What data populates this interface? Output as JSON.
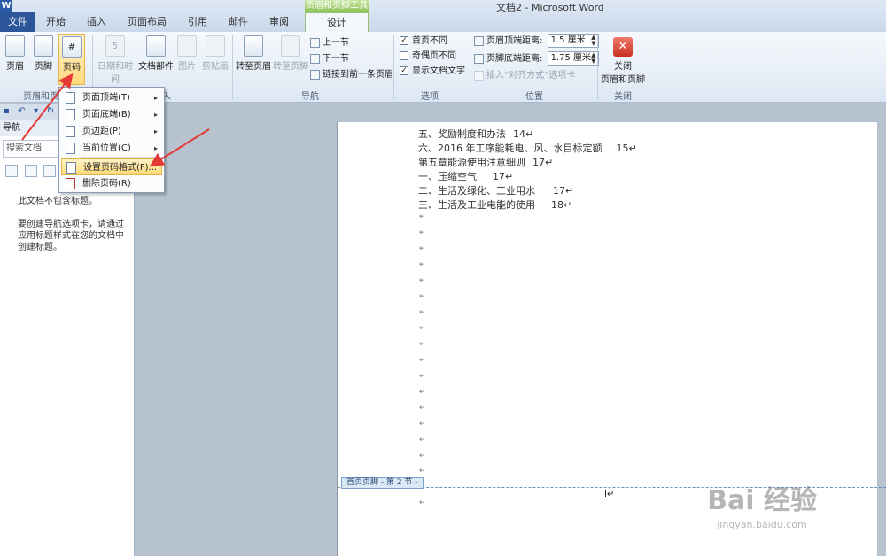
{
  "window": {
    "app_icon": "W",
    "title": "文档2 - Microsoft Word",
    "context_tab_group": "页眉和页脚工具"
  },
  "tabs": [
    {
      "label": "文件"
    },
    {
      "label": "开始"
    },
    {
      "label": "插入"
    },
    {
      "label": "页面布局"
    },
    {
      "label": "引用"
    },
    {
      "label": "邮件"
    },
    {
      "label": "审阅"
    },
    {
      "label": "视图"
    },
    {
      "label": "设计"
    }
  ],
  "ribbon": {
    "header_footer_group": {
      "label": "页眉和页",
      "buttons": [
        {
          "label": "页眉",
          "icon": "header-icon"
        },
        {
          "label": "页脚",
          "icon": "footer-icon"
        },
        {
          "label": "页码",
          "icon": "page-number-icon",
          "glyph": "#"
        }
      ]
    },
    "insert_group": {
      "label": "入",
      "buttons": [
        {
          "label": "日期和时间",
          "icon": "calendar-icon",
          "glyph": "5"
        },
        {
          "label": "文档部件",
          "icon": "quick-parts-icon"
        },
        {
          "label": "图片",
          "icon": "picture-icon"
        },
        {
          "label": "剪贴画",
          "icon": "clip-art-icon"
        }
      ]
    },
    "nav_group": {
      "label": "导航",
      "buttons": [
        {
          "label": "转至页眉",
          "icon": "goto-header-icon"
        },
        {
          "label": "转至页脚",
          "icon": "goto-footer-icon"
        }
      ],
      "small": [
        {
          "label": "上一节",
          "icon": "previous-section-icon"
        },
        {
          "label": "下一节",
          "icon": "next-section-icon"
        },
        {
          "label": "链接到前一条页眉",
          "icon": "link-previous-icon"
        }
      ]
    },
    "options_group": {
      "label": "选项",
      "checks": [
        {
          "label": "首页不同",
          "checked": true
        },
        {
          "label": "奇偶页不同",
          "checked": false
        },
        {
          "label": "显示文档文字",
          "checked": true
        }
      ]
    },
    "position_group": {
      "label": "位置",
      "header_distance_label": "页眉顶端距离:",
      "header_distance_value": "1.5 厘米",
      "footer_distance_label": "页脚底端距离:",
      "footer_distance_value": "1.75 厘米",
      "insert_align_tab": "插入“对齐方式”选项卡"
    },
    "close_group": {
      "label": "关闭",
      "button_line1": "关闭",
      "button_line2": "页眉和页脚",
      "glyph": "✕"
    }
  },
  "qat": {
    "save": "▪",
    "undo": "↶",
    "undo_arrow": "▾",
    "redo": "↻"
  },
  "nav_pane": {
    "title": "导航",
    "search_placeholder": "搜索文档",
    "message1": "此文档不包含标题。",
    "message2": "要创建导航选项卡，请通过应用标题样式在您的文档中创建标题。"
  },
  "menu": {
    "items": [
      {
        "label": "页面顶端(T)",
        "submenu": true,
        "icon": "page-top-icon"
      },
      {
        "label": "页面底端(B)",
        "submenu": true,
        "icon": "page-bottom-icon"
      },
      {
        "label": "页边距(P)",
        "submenu": true,
        "icon": "page-margin-icon"
      },
      {
        "label": "当前位置(C)",
        "submenu": true,
        "icon": "current-position-icon"
      },
      {
        "label": "设置页码格式(F)...",
        "submenu": false,
        "icon": "format-page-number-icon",
        "highlighted": true
      },
      {
        "label": "删除页码(R)",
        "submenu": false,
        "icon": "remove-page-number-icon"
      }
    ],
    "submenu_arrow": "▸"
  },
  "document": {
    "toc": [
      {
        "text": "五、奖励制度和办法",
        "page": "14↵"
      },
      {
        "text": "六、2016 年工序能耗电、风、水目标定额",
        "page": "15↵"
      },
      {
        "text": "第五章能源使用注意细则",
        "page": "17↵"
      },
      {
        "text": "一、压缩空气",
        "page": "17↵"
      },
      {
        "text": "二、生活及绿化、工业用水",
        "page": "17↵"
      },
      {
        "text": "三、生活及工业电能的使用",
        "page": "18↵"
      }
    ],
    "paragraph_mark": "↵",
    "footer_tag": "首页页脚 - 第 2 节 -",
    "cursor": "I↵"
  },
  "watermark": {
    "text": "Bai 经验",
    "url": "jingyan.baidu.com"
  },
  "colors": {
    "file_tab": "#2b579a",
    "context_tab": "#8cc256",
    "arrow": "#e53935",
    "highlight": "#ffd97a"
  }
}
